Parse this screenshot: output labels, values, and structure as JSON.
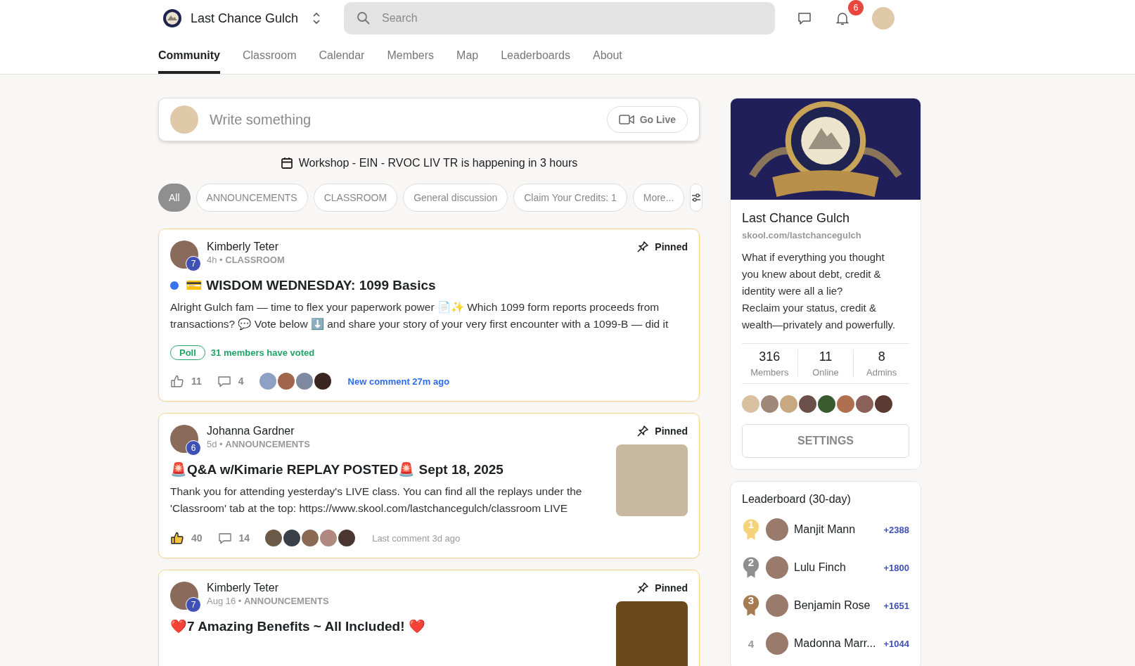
{
  "header": {
    "community_name": "Last Chance Gulch",
    "search": {
      "placeholder": "Search"
    },
    "notification_count": "6"
  },
  "tabs": [
    {
      "label": "Community",
      "selected": true
    },
    {
      "label": "Classroom",
      "selected": false
    },
    {
      "label": "Calendar",
      "selected": false
    },
    {
      "label": "Members",
      "selected": false
    },
    {
      "label": "Map",
      "selected": false
    },
    {
      "label": "Leaderboards",
      "selected": false
    },
    {
      "label": "About",
      "selected": false
    }
  ],
  "composer": {
    "placeholder": "Write something",
    "go_live": "Go Live"
  },
  "event_banner": {
    "event": "Workshop - EIN - RVOC LIV TR",
    "suffix": "is happening in 3 hours"
  },
  "filters": [
    {
      "label": "All",
      "selected": true
    },
    {
      "label": "ANNOUNCEMENTS",
      "selected": false
    },
    {
      "label": "CLASSROOM",
      "selected": false
    },
    {
      "label": "General discussion",
      "selected": false
    },
    {
      "label": "Claim Your Credits: 1",
      "selected": false
    },
    {
      "label": "More...",
      "selected": false
    }
  ],
  "posts": [
    {
      "author": "Kimberly Teter",
      "level": "7",
      "time": "4h •",
      "category": "CLASSROOM",
      "pinned_label": "Pinned",
      "unread": true,
      "title": "💳 WISDOM WEDNESDAY: 1099 Basics",
      "body": "Alright Gulch fam — time to flex your paperwork power 📄✨ Which 1099 form reports proceeds from transactions? 💬 Vote below ⬇️ and share your story of your very first encounter with a 1099-B — did it",
      "poll": {
        "label": "Poll",
        "votes": "31 members have voted"
      },
      "liked": false,
      "likes": "11",
      "comments": "4",
      "commenter_avatars": [
        {
          "color": "#8ea0c4"
        },
        {
          "color": "#a0654a"
        },
        {
          "color": "#7d8aa0"
        },
        {
          "color": "#3a2520"
        }
      ],
      "activity": "New comment 27m ago",
      "activity_new": true
    },
    {
      "author": "Johanna Gardner",
      "level": "6",
      "time": "5d •",
      "category": "ANNOUNCEMENTS",
      "pinned_label": "Pinned",
      "unread": false,
      "title": "🚨Q&A w/Kimarie REPLAY POSTED🚨 Sept 18, 2025",
      "body": "Thank you for attending yesterday's LIVE class. You can find all the replays under the 'Classroom' tab at the top: https://www.skool.com/lastchancegulch/classroom LIVE",
      "liked": true,
      "likes": "40",
      "comments": "14",
      "commenter_avatars": [
        {
          "color": "#6b5a48"
        },
        {
          "color": "#3a4048"
        },
        {
          "color": "#8a6a55"
        },
        {
          "color": "#b08a80"
        },
        {
          "color": "#4a3530"
        }
      ],
      "activity": "Last comment 3d ago",
      "activity_new": false,
      "thumbnail": true
    },
    {
      "author": "Kimberly Teter",
      "level": "7",
      "time": "Aug 16 •",
      "category": "ANNOUNCEMENTS",
      "pinned_label": "Pinned",
      "unread": false,
      "title": "❤️7 Amazing Benefits ~ All Included! ❤️",
      "thumbnail": true
    }
  ],
  "about": {
    "name": "Last Chance Gulch",
    "url": "skool.com/lastchancegulch",
    "description": [
      "What if everything you thought you knew about debt, credit & identity were all a lie?",
      "Reclaim your status, credit & wealth—privately and powerfully."
    ],
    "stats": [
      {
        "value": "316",
        "label": "Members"
      },
      {
        "value": "11",
        "label": "Online"
      },
      {
        "value": "8",
        "label": "Admins"
      }
    ],
    "member_avatars": [
      {
        "color": "#d8c0a0"
      },
      {
        "color": "#a08878"
      },
      {
        "color": "#c8a880"
      },
      {
        "color": "#6a5048"
      },
      {
        "color": "#3a5a30"
      },
      {
        "color": "#b07050"
      },
      {
        "color": "#8a6058"
      },
      {
        "color": "#5a3a30"
      }
    ],
    "settings_button": "SETTINGS"
  },
  "leaderboard": {
    "title": "Leaderboard (30-day)",
    "rows": [
      {
        "rank": "1",
        "color": "#f6d27a",
        "name": "Manjit Mann",
        "points": "+2388"
      },
      {
        "rank": "2",
        "color": "#8f8f8f",
        "name": "Lulu Finch",
        "points": "+1800"
      },
      {
        "rank": "3",
        "color": "#a57c52",
        "name": "Benjamin Rose",
        "points": "+1651"
      },
      {
        "rank": "4",
        "name": "Madonna Marr...",
        "points": "+1044"
      }
    ]
  }
}
